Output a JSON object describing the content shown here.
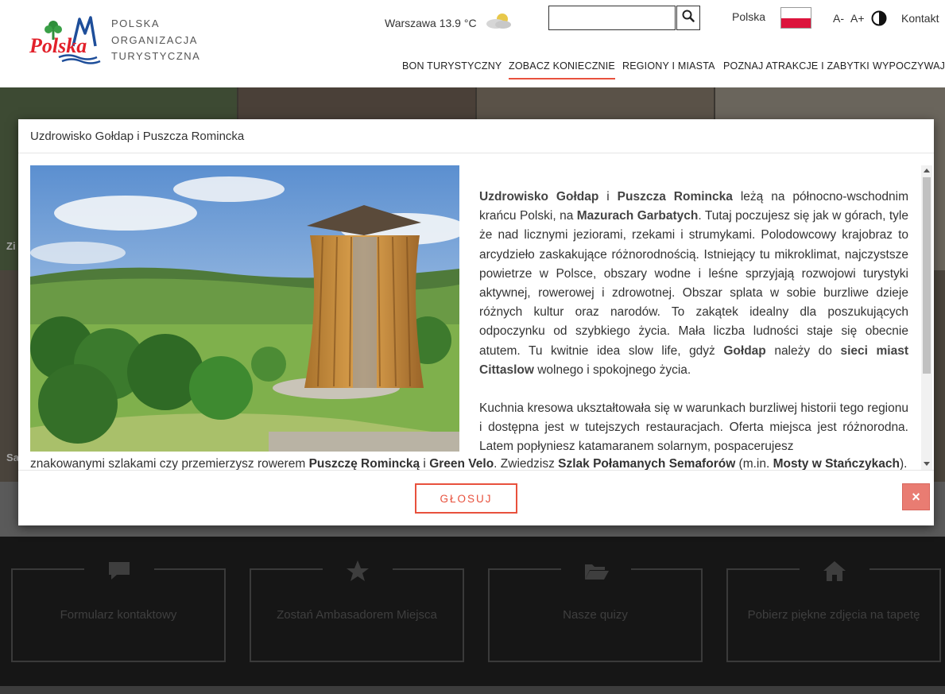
{
  "header": {
    "logo_alt": "Polska",
    "org_name_lines": [
      "POLSKA",
      "ORGANIZACJA",
      "TURYSTYCZNA"
    ],
    "weather_text": "Warszawa 13.9 °C",
    "weather_icon": "partly-cloudy-icon",
    "search": {
      "placeholder": "",
      "value": ""
    },
    "language": "Polska",
    "font_smaller": "A-",
    "font_bigger": "A+",
    "contact": "Kontakt"
  },
  "nav": {
    "items": [
      {
        "label": "BON TURYSTYCZNY",
        "active": false
      },
      {
        "label": "ZOBACZ KONIECZNIE",
        "active": true
      },
      {
        "label": "REGIONY I MIASTA",
        "active": false
      },
      {
        "label": "POZNAJ ATRAKCJE I ZABYTKI",
        "active": false
      },
      {
        "label": "WYPOCZYWAJ",
        "active": false
      }
    ]
  },
  "modal": {
    "title": "Uzdrowisko Gołdap i Puszcza Romincka",
    "vote_label": "GŁOSUJ",
    "close_label": "×",
    "paragraph1": [
      {
        "t": "Uzdrowisko Gołdap",
        "b": true
      },
      {
        "t": " i ",
        "b": false
      },
      {
        "t": "Puszcza Romincka",
        "b": true
      },
      {
        "t": " leżą na północno-wschodnim krańcu Polski, na ",
        "b": false
      },
      {
        "t": "Mazurach Garbatych",
        "b": true
      },
      {
        "t": ". Tutaj poczujesz się jak w górach, tyle że nad licznymi jeziorami, rzekami i strumykami. Polodowcowy krajobraz to arcydzieło zaskakujące różnorodnością. Istniejący tu mikroklimat, najczystsze powietrze w Polsce, obszary wodne i leśne sprzyjają rozwojowi turystyki aktywnej, rowerowej i zdrowotnej. Obszar splata w sobie burzliwe dzieje różnych kultur oraz narodów. To zakątek idealny dla poszukujących odpoczynku od szybkiego życia. Mała liczba ludności staje się obecnie atutem. Tu kwitnie idea slow life, gdyż ",
        "b": false
      },
      {
        "t": "Gołdap",
        "b": true
      },
      {
        "t": " należy do ",
        "b": false
      },
      {
        "t": "sieci miast Cittaslow",
        "b": true
      },
      {
        "t": " wolnego i spokojnego życia.",
        "b": false
      }
    ],
    "paragraph2_upper": "Kuchnia kresowa ukształtowała się w warunkach burzliwej historii tego regionu i dostępna jest w tutejszych restauracjach. Oferta miejsca jest różnorodna. Latem popłyniesz katamaranem solarnym, pospacerujesz",
    "paragraph2_lower": [
      {
        "t": "znakowanymi szlakami czy przemierzysz rowerem ",
        "b": false
      },
      {
        "t": "Puszczę Romincką",
        "b": true
      },
      {
        "t": " i ",
        "b": false
      },
      {
        "t": "Green Velo",
        "b": true
      },
      {
        "t": ". Zwiedzisz ",
        "b": false
      },
      {
        "t": "Szlak Połamanych Semaforów",
        "b": true
      },
      {
        "t": " (m.in. ",
        "b": false
      },
      {
        "t": "Mosty w Stańczykach",
        "b": true
      },
      {
        "t": ").",
        "b": false
      }
    ]
  },
  "background": {
    "side_letters": [
      "Zi",
      "Sa"
    ]
  },
  "footer_boxes": [
    {
      "label": "Formularz kontaktowy",
      "icon": "comment-icon"
    },
    {
      "label": "Zostań Ambasadorem Miejsca",
      "icon": "star-icon"
    },
    {
      "label": "Nasze quizy",
      "icon": "folder-open-icon"
    },
    {
      "label": "Pobierz piękne zdjęcia na tapetę",
      "icon": "home-icon"
    }
  ],
  "colors": {
    "accent": "#e8513d",
    "close_button": "#e97c72",
    "footer_bg": "#161616"
  }
}
